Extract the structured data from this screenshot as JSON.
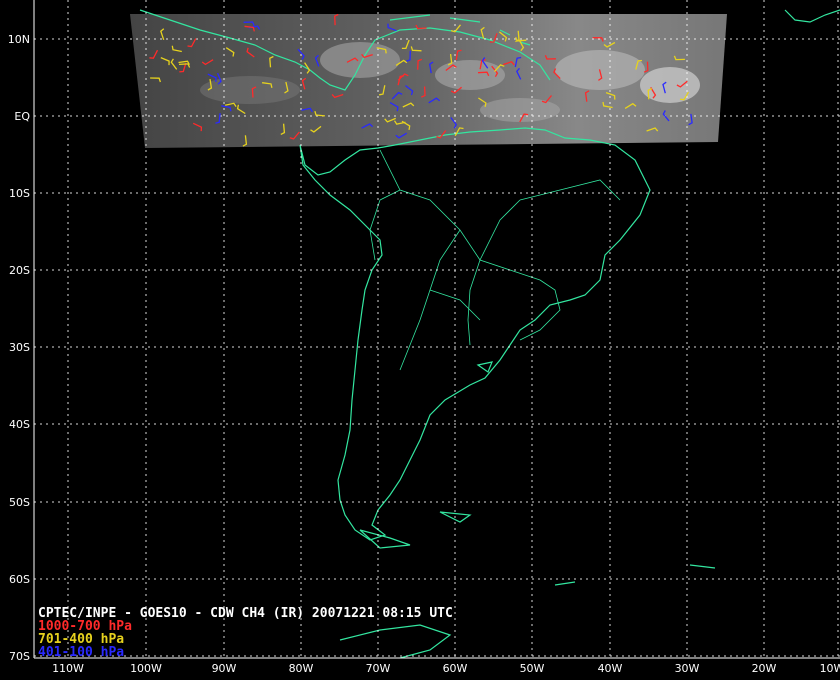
{
  "title": "CPTEC/INPE - GOES10 - CDW CH4 (IR) 20071221 08:15 UTC",
  "legend": [
    {
      "label": "1000-700 hPa",
      "color": "#ff2a2a"
    },
    {
      "label": "701-400 hPa",
      "color": "#e6d21e"
    },
    {
      "label": "401-100 hPa",
      "color": "#2a2aff"
    }
  ],
  "lat_labels": [
    "10N",
    "EQ",
    "10S",
    "20S",
    "30S",
    "40S",
    "50S",
    "60S",
    "70S"
  ],
  "lon_labels": [
    "110W",
    "100W",
    "90W",
    "80W",
    "70W",
    "60W",
    "50W",
    "40W",
    "30W",
    "20W",
    "10W"
  ],
  "colors": {
    "background": "#000000",
    "coastline": "#33e6a0",
    "grid": "#ffffff",
    "axis_panel": "#000000"
  }
}
